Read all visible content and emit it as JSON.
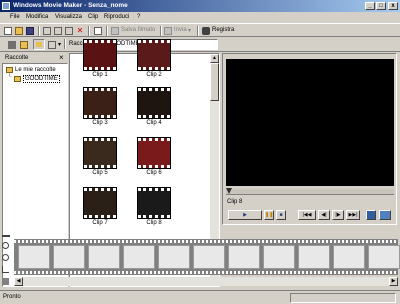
{
  "window": {
    "title": "Windows Movie Maker - Senza_nome"
  },
  "window_controls": {
    "minimize": "_",
    "maximize": "□",
    "close": "x"
  },
  "menu": [
    "File",
    "Modifica",
    "Visualizza",
    "Clip",
    "Riproduci",
    "?"
  ],
  "toolbar": {
    "salva_filmato": "Salva filmato",
    "invia": "Invia",
    "registra": "Registra"
  },
  "collections_bar": {
    "label": "Raccolta",
    "current": "GOODTIME"
  },
  "tree": {
    "header": "Raccolte",
    "close_glyph": "×",
    "root": "Le mie raccolte",
    "child": "GOODTIME"
  },
  "clips": [
    {
      "label": "Clip 1",
      "color": "#5a1212"
    },
    {
      "label": "Clip 2",
      "color": "#5a1a1a"
    },
    {
      "label": "Clip 3",
      "color": "#3a2016"
    },
    {
      "label": "Clip 4",
      "color": "#1e1410"
    },
    {
      "label": "Clip 5",
      "color": "#3a2a1e"
    },
    {
      "label": "Clip 6",
      "color": "#7a1a1a"
    },
    {
      "label": "Clip 7",
      "color": "#2a2018"
    },
    {
      "label": "Clip 8",
      "color": "#1a1a1a"
    }
  ],
  "preview": {
    "clip_name": "Clip 8"
  },
  "status": {
    "text": "Pronto"
  }
}
